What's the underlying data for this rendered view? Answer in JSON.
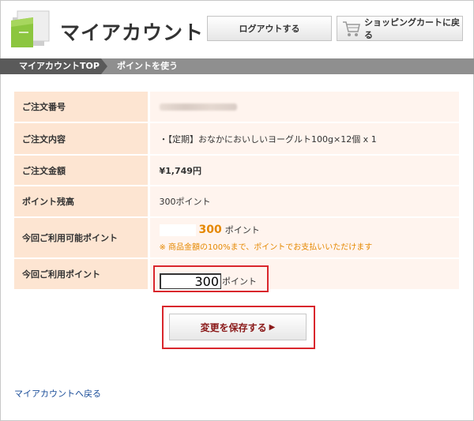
{
  "header": {
    "title": "マイアカウント",
    "logout_label": "ログアウトする",
    "cart_label": "ショッピングカートに戻る"
  },
  "breadcrumb": {
    "home": "マイアカウントTOP",
    "current": "ポイントを使う"
  },
  "form": {
    "order_number_label": "ご注文番号",
    "order_content_label": "ご注文内容",
    "order_content_value": "・【定期】おなかにおいしいヨーグルト100g×12個 x 1",
    "order_amount_label": "ご注文金額",
    "order_amount_value": "¥1,749円",
    "point_balance_label": "ポイント残高",
    "point_balance_value": "300ポイント",
    "available_label": "今回ご利用可能ポイント",
    "available_value": "300",
    "available_unit": "ポイント",
    "available_note": "※ 商品金額の100%まで、ポイントでお支払いいただけます",
    "use_label": "今回ご利用ポイント",
    "use_value": "300",
    "use_unit": "ポイント"
  },
  "actions": {
    "save_label": "変更を保存する",
    "save_arrow": "▶",
    "back_link": "マイアカウントへ戻る"
  },
  "colors": {
    "accent_red": "#d9262c",
    "label_bg": "#fde5d2",
    "value_bg": "#fff4ee",
    "orange": "#e58800",
    "link": "#1a4d99"
  }
}
